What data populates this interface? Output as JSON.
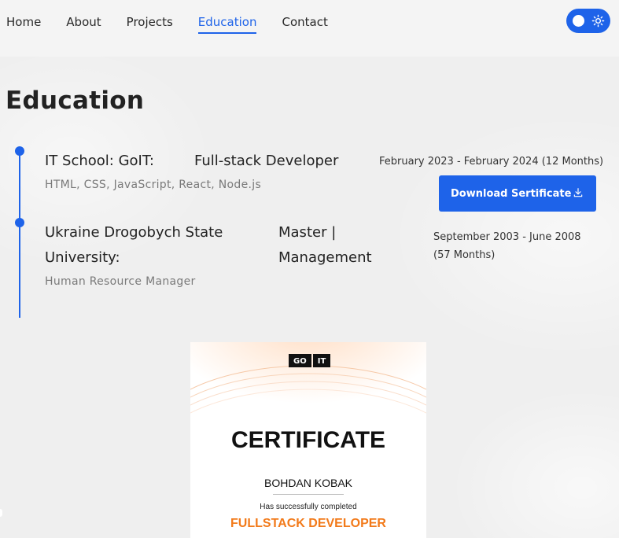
{
  "nav": {
    "links": [
      "Home",
      "About",
      "Projects",
      "Education",
      "Contact"
    ],
    "active": "Education"
  },
  "theme_toggle": {
    "icon": "sun-icon",
    "state": "light"
  },
  "page_title": "Education",
  "education": [
    {
      "school": "IT School: GoIT:",
      "degree": "Full-stack Developer",
      "details": "HTML, CSS, JavaScript, React, Node.js",
      "dates": "February 2023 - February 2024 (12 Months)",
      "button_label": "Download Sertificate"
    },
    {
      "school_line1": "Ukraine Drogobych State",
      "school_line2": "University:",
      "degree_line1": "Master |",
      "degree_line2": "Management",
      "details": "Human Resource Manager",
      "dates_line1": "September 2003 - June 2008",
      "dates_line2": "(57 Months)"
    }
  ],
  "certificate": {
    "logo_left": "GO",
    "logo_right": "IT",
    "title": "CERTIFICATE",
    "name": "BOHDAN KOBAK",
    "completed_text": "Has successfully completed",
    "course": "FULLSTACK DEVELOPER"
  },
  "colors": {
    "accent": "#1e63e9",
    "certificate_course": "#f27a1a"
  }
}
